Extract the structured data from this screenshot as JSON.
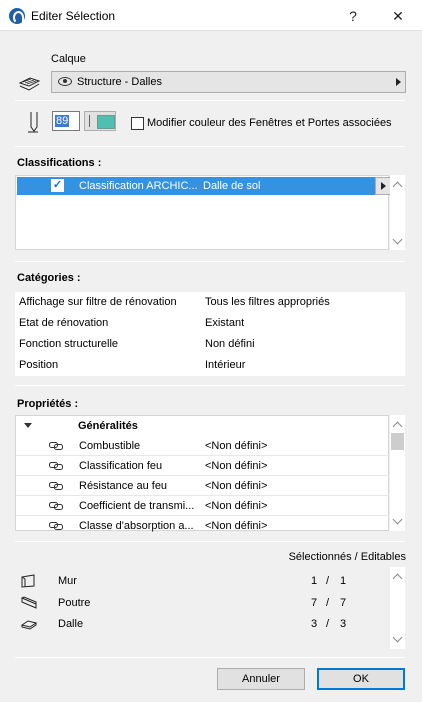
{
  "window": {
    "title": "Editer Sélection",
    "help_label": "?",
    "close_label": "✕"
  },
  "layer": {
    "label": "Calque",
    "value": "Structure - Dalles"
  },
  "pen": {
    "value": "89",
    "checkbox_label": "Modifier couleur des Fenêtres et Portes associées",
    "checkbox_checked": false
  },
  "classifications": {
    "title": "Classifications :",
    "rows": [
      {
        "checked": "✓",
        "name": "Classification ARCHIC...",
        "value": "Dalle de sol"
      }
    ]
  },
  "categories": {
    "title": "Catégories :",
    "rows": [
      {
        "key": "Affichage sur filtre de rénovation",
        "value": "Tous les filtres appropriés"
      },
      {
        "key": "Etat de rénovation",
        "value": "Existant"
      },
      {
        "key": "Fonction structurelle",
        "value": "Non défini"
      },
      {
        "key": "Position",
        "value": "Intérieur"
      }
    ]
  },
  "properties": {
    "title": "Propriétés :",
    "group": "Généralités",
    "rows": [
      {
        "key": "Combustible",
        "value": "<Non défini>"
      },
      {
        "key": "Classification feu",
        "value": "<Non défini>"
      },
      {
        "key": "Résistance au feu",
        "value": "<Non défini>"
      },
      {
        "key": "Coefficient de transmi...",
        "value": "<Non défini>"
      },
      {
        "key": "Classe d'absorption a...",
        "value": "<Non défini>"
      }
    ]
  },
  "selection": {
    "header": "Sélectionnés / Editables",
    "rows": [
      {
        "icon": "wall-icon",
        "name": "Mur",
        "selected": "1",
        "sep": "/",
        "editable": "1"
      },
      {
        "icon": "beam-icon",
        "name": "Poutre",
        "selected": "7",
        "sep": "/",
        "editable": "7"
      },
      {
        "icon": "slab-icon",
        "name": "Dalle",
        "selected": "3",
        "sep": "/",
        "editable": "3"
      }
    ]
  },
  "buttons": {
    "cancel": "Annuler",
    "ok": "OK"
  },
  "colors": {
    "selection": "#3592e0",
    "accent": "#0078d7",
    "swatch": "#4fc0b0"
  }
}
